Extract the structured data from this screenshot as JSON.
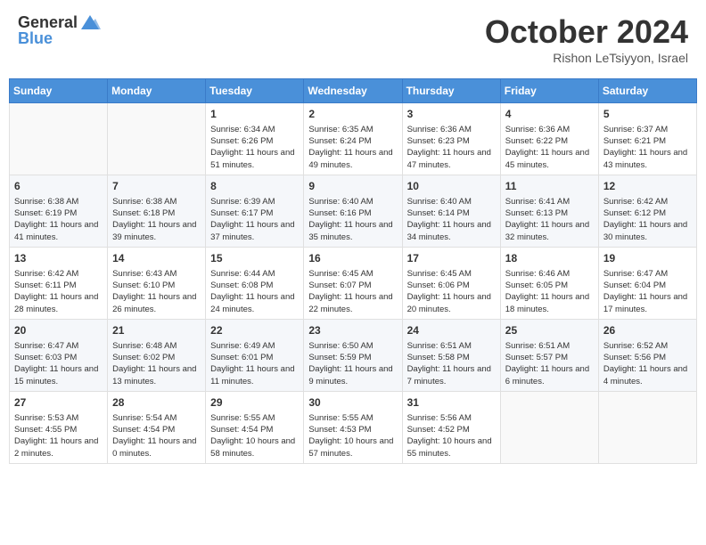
{
  "header": {
    "logo_line1": "General",
    "logo_line2": "Blue",
    "month": "October 2024",
    "location": "Rishon LeTsiyyon, Israel"
  },
  "days_of_week": [
    "Sunday",
    "Monday",
    "Tuesday",
    "Wednesday",
    "Thursday",
    "Friday",
    "Saturday"
  ],
  "weeks": [
    [
      {
        "day": "",
        "sunrise": "",
        "sunset": "",
        "daylight": ""
      },
      {
        "day": "",
        "sunrise": "",
        "sunset": "",
        "daylight": ""
      },
      {
        "day": "1",
        "sunrise": "Sunrise: 6:34 AM",
        "sunset": "Sunset: 6:26 PM",
        "daylight": "Daylight: 11 hours and 51 minutes."
      },
      {
        "day": "2",
        "sunrise": "Sunrise: 6:35 AM",
        "sunset": "Sunset: 6:24 PM",
        "daylight": "Daylight: 11 hours and 49 minutes."
      },
      {
        "day": "3",
        "sunrise": "Sunrise: 6:36 AM",
        "sunset": "Sunset: 6:23 PM",
        "daylight": "Daylight: 11 hours and 47 minutes."
      },
      {
        "day": "4",
        "sunrise": "Sunrise: 6:36 AM",
        "sunset": "Sunset: 6:22 PM",
        "daylight": "Daylight: 11 hours and 45 minutes."
      },
      {
        "day": "5",
        "sunrise": "Sunrise: 6:37 AM",
        "sunset": "Sunset: 6:21 PM",
        "daylight": "Daylight: 11 hours and 43 minutes."
      }
    ],
    [
      {
        "day": "6",
        "sunrise": "Sunrise: 6:38 AM",
        "sunset": "Sunset: 6:19 PM",
        "daylight": "Daylight: 11 hours and 41 minutes."
      },
      {
        "day": "7",
        "sunrise": "Sunrise: 6:38 AM",
        "sunset": "Sunset: 6:18 PM",
        "daylight": "Daylight: 11 hours and 39 minutes."
      },
      {
        "day": "8",
        "sunrise": "Sunrise: 6:39 AM",
        "sunset": "Sunset: 6:17 PM",
        "daylight": "Daylight: 11 hours and 37 minutes."
      },
      {
        "day": "9",
        "sunrise": "Sunrise: 6:40 AM",
        "sunset": "Sunset: 6:16 PM",
        "daylight": "Daylight: 11 hours and 35 minutes."
      },
      {
        "day": "10",
        "sunrise": "Sunrise: 6:40 AM",
        "sunset": "Sunset: 6:14 PM",
        "daylight": "Daylight: 11 hours and 34 minutes."
      },
      {
        "day": "11",
        "sunrise": "Sunrise: 6:41 AM",
        "sunset": "Sunset: 6:13 PM",
        "daylight": "Daylight: 11 hours and 32 minutes."
      },
      {
        "day": "12",
        "sunrise": "Sunrise: 6:42 AM",
        "sunset": "Sunset: 6:12 PM",
        "daylight": "Daylight: 11 hours and 30 minutes."
      }
    ],
    [
      {
        "day": "13",
        "sunrise": "Sunrise: 6:42 AM",
        "sunset": "Sunset: 6:11 PM",
        "daylight": "Daylight: 11 hours and 28 minutes."
      },
      {
        "day": "14",
        "sunrise": "Sunrise: 6:43 AM",
        "sunset": "Sunset: 6:10 PM",
        "daylight": "Daylight: 11 hours and 26 minutes."
      },
      {
        "day": "15",
        "sunrise": "Sunrise: 6:44 AM",
        "sunset": "Sunset: 6:08 PM",
        "daylight": "Daylight: 11 hours and 24 minutes."
      },
      {
        "day": "16",
        "sunrise": "Sunrise: 6:45 AM",
        "sunset": "Sunset: 6:07 PM",
        "daylight": "Daylight: 11 hours and 22 minutes."
      },
      {
        "day": "17",
        "sunrise": "Sunrise: 6:45 AM",
        "sunset": "Sunset: 6:06 PM",
        "daylight": "Daylight: 11 hours and 20 minutes."
      },
      {
        "day": "18",
        "sunrise": "Sunrise: 6:46 AM",
        "sunset": "Sunset: 6:05 PM",
        "daylight": "Daylight: 11 hours and 18 minutes."
      },
      {
        "day": "19",
        "sunrise": "Sunrise: 6:47 AM",
        "sunset": "Sunset: 6:04 PM",
        "daylight": "Daylight: 11 hours and 17 minutes."
      }
    ],
    [
      {
        "day": "20",
        "sunrise": "Sunrise: 6:47 AM",
        "sunset": "Sunset: 6:03 PM",
        "daylight": "Daylight: 11 hours and 15 minutes."
      },
      {
        "day": "21",
        "sunrise": "Sunrise: 6:48 AM",
        "sunset": "Sunset: 6:02 PM",
        "daylight": "Daylight: 11 hours and 13 minutes."
      },
      {
        "day": "22",
        "sunrise": "Sunrise: 6:49 AM",
        "sunset": "Sunset: 6:01 PM",
        "daylight": "Daylight: 11 hours and 11 minutes."
      },
      {
        "day": "23",
        "sunrise": "Sunrise: 6:50 AM",
        "sunset": "Sunset: 5:59 PM",
        "daylight": "Daylight: 11 hours and 9 minutes."
      },
      {
        "day": "24",
        "sunrise": "Sunrise: 6:51 AM",
        "sunset": "Sunset: 5:58 PM",
        "daylight": "Daylight: 11 hours and 7 minutes."
      },
      {
        "day": "25",
        "sunrise": "Sunrise: 6:51 AM",
        "sunset": "Sunset: 5:57 PM",
        "daylight": "Daylight: 11 hours and 6 minutes."
      },
      {
        "day": "26",
        "sunrise": "Sunrise: 6:52 AM",
        "sunset": "Sunset: 5:56 PM",
        "daylight": "Daylight: 11 hours and 4 minutes."
      }
    ],
    [
      {
        "day": "27",
        "sunrise": "Sunrise: 5:53 AM",
        "sunset": "Sunset: 4:55 PM",
        "daylight": "Daylight: 11 hours and 2 minutes."
      },
      {
        "day": "28",
        "sunrise": "Sunrise: 5:54 AM",
        "sunset": "Sunset: 4:54 PM",
        "daylight": "Daylight: 11 hours and 0 minutes."
      },
      {
        "day": "29",
        "sunrise": "Sunrise: 5:55 AM",
        "sunset": "Sunset: 4:54 PM",
        "daylight": "Daylight: 10 hours and 58 minutes."
      },
      {
        "day": "30",
        "sunrise": "Sunrise: 5:55 AM",
        "sunset": "Sunset: 4:53 PM",
        "daylight": "Daylight: 10 hours and 57 minutes."
      },
      {
        "day": "31",
        "sunrise": "Sunrise: 5:56 AM",
        "sunset": "Sunset: 4:52 PM",
        "daylight": "Daylight: 10 hours and 55 minutes."
      },
      {
        "day": "",
        "sunrise": "",
        "sunset": "",
        "daylight": ""
      },
      {
        "day": "",
        "sunrise": "",
        "sunset": "",
        "daylight": ""
      }
    ]
  ]
}
